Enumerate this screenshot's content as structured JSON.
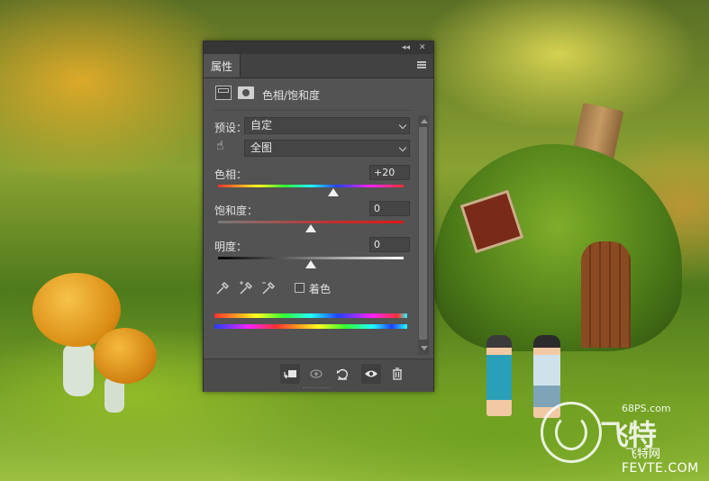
{
  "panel": {
    "tab_label": "属性",
    "adjustment_title": "色相/饱和度",
    "preset": {
      "label": "预设：",
      "value": "自定"
    },
    "channel": {
      "value": "全图"
    },
    "hue": {
      "label": "色相：",
      "value": "+20",
      "level": 0.62
    },
    "saturation": {
      "label": "饱和度：",
      "value": "0",
      "level": 0.5
    },
    "lightness": {
      "label": "明度：",
      "value": "0",
      "level": 0.5
    },
    "colorize_label": "着色",
    "colorize_checked": false
  },
  "icons": {
    "collapse": "double-chevron-icon",
    "close": "close-icon",
    "menu": "panel-menu-icon",
    "adjustment": "hue-saturation-adjustment-icon",
    "mask": "layer-mask-icon",
    "hand": "targeted-adjustment-hand-icon",
    "eyedroppers": [
      "eyedropper-icon",
      "eyedropper-plus-icon",
      "eyedropper-minus-icon"
    ],
    "footer": [
      "clip-to-layer-icon",
      "view-previous-state-icon",
      "reset-icon",
      "visibility-eye-icon",
      "trash-icon"
    ]
  },
  "watermark": {
    "small_text": "68PS.com",
    "big_text": "飞特",
    "brand_cn": "飞特网",
    "site": "FEVTE.COM"
  },
  "colors": {
    "panel_bg": "#535353",
    "panel_dark": "#424242",
    "text": "#e0e0e0"
  }
}
